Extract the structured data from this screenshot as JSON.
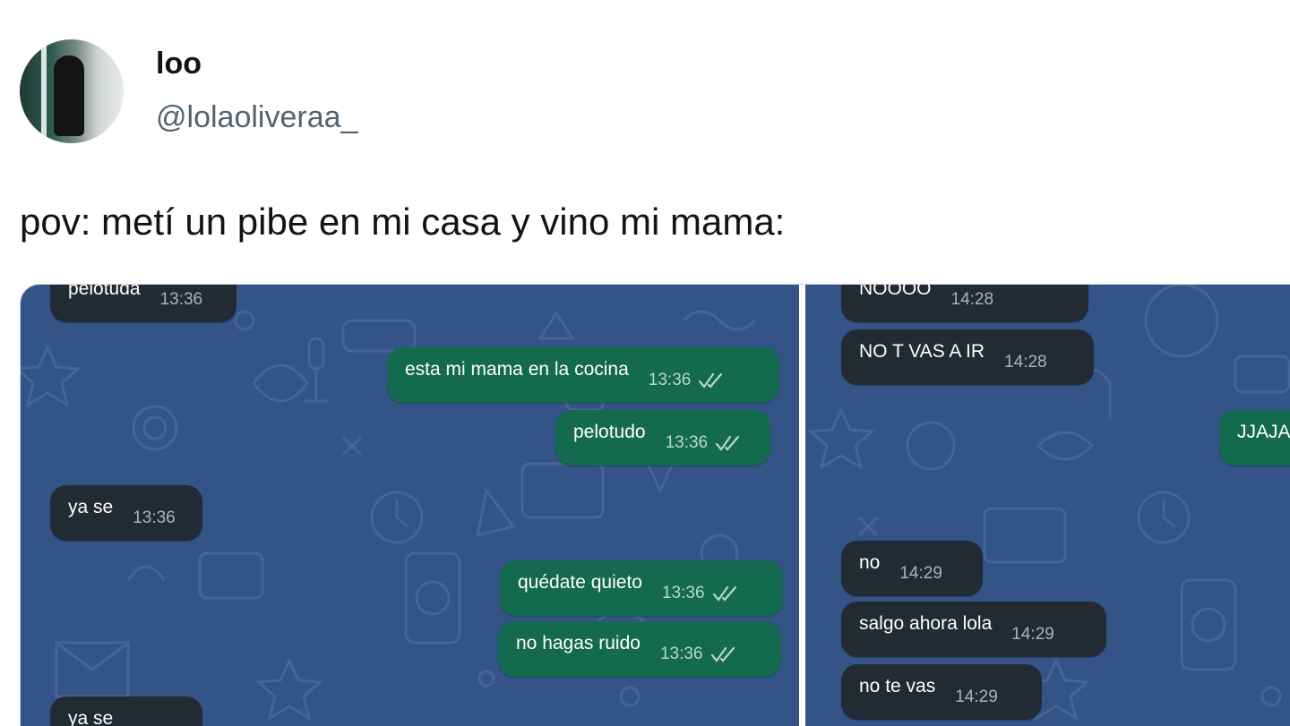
{
  "author": {
    "display_name": "loo",
    "handle": "@lolaoliveraa_"
  },
  "tweet": {
    "text": "pov: metí un pibe en mi casa y vino mi mama:"
  },
  "chat_left": {
    "messages": [
      {
        "dir": "in",
        "text": "pelotuda",
        "time": "13:36",
        "read": false
      },
      {
        "dir": "out",
        "text": "esta mi mama en la cocina",
        "time": "13:36",
        "read": true
      },
      {
        "dir": "out",
        "text": "pelotudo",
        "time": "13:36",
        "read": true
      },
      {
        "dir": "in",
        "text": "ya se",
        "time": "13:36",
        "read": false
      },
      {
        "dir": "out",
        "text": "quédate quieto",
        "time": "13:36",
        "read": true
      },
      {
        "dir": "out",
        "text": "no hagas ruido",
        "time": "13:36",
        "read": true
      },
      {
        "dir": "in",
        "text": "ya se",
        "time": "",
        "read": false
      }
    ]
  },
  "chat_right": {
    "messages": [
      {
        "dir": "in",
        "text": "NOOOO",
        "time": "14:28",
        "read": false
      },
      {
        "dir": "in",
        "text": "NO T VAS A IR",
        "time": "14:28",
        "read": false
      },
      {
        "dir": "out",
        "text": "JJAJA",
        "time": "",
        "read": false
      },
      {
        "dir": "in",
        "text": "no",
        "time": "14:29",
        "read": false
      },
      {
        "dir": "in",
        "text": "salgo ahora lola",
        "time": "14:29",
        "read": false
      },
      {
        "dir": "in",
        "text": "no te vas",
        "time": "14:29",
        "read": false
      }
    ]
  },
  "colors": {
    "chat_bg": "#345387",
    "incoming_bubble": "#222b33",
    "outgoing_bubble": "#136a4f",
    "read_ticks": "#b8d7cb"
  },
  "icons": [
    "double-check-icon",
    "chat-wallpaper-doodles"
  ]
}
